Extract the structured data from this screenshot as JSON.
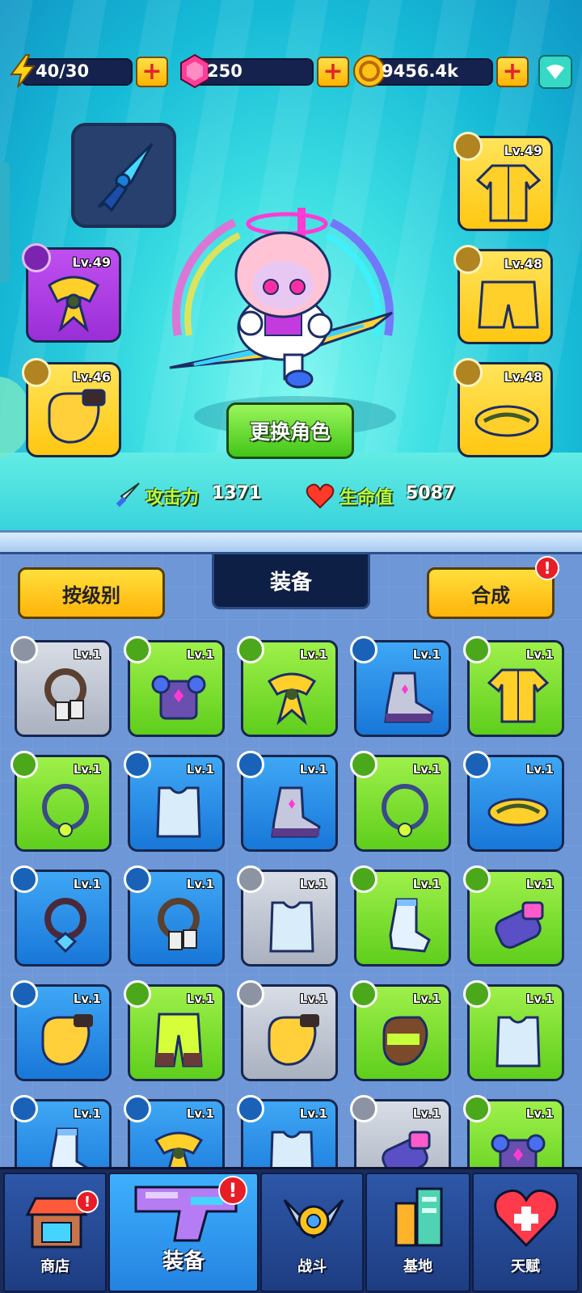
{
  "resources": {
    "energy": "40/30",
    "gems": "250",
    "coins": "9456.4k"
  },
  "hero_slots": {
    "left": [
      {
        "slot": "necklace",
        "level": "Lv.49",
        "rarity": "purple"
      },
      {
        "slot": "glove",
        "level": "Lv.46",
        "rarity": "yellow"
      }
    ],
    "right": [
      {
        "slot": "armor",
        "level": "Lv.49",
        "rarity": "yellow"
      },
      {
        "slot": "pants",
        "level": "Lv.48",
        "rarity": "yellow"
      },
      {
        "slot": "shoes",
        "level": "Lv.48",
        "rarity": "yellow"
      }
    ]
  },
  "change_character_label": "更换角色",
  "stats": {
    "attack_label": "攻击力",
    "attack_value": "1371",
    "hp_label": "生命值",
    "hp_value": "5087"
  },
  "inventory": {
    "sort_label": "按级别",
    "tab_title": "装备",
    "compose_label": "合成",
    "compose_badge": "!",
    "items": [
      {
        "type": "necklace",
        "rarity": "gray",
        "level": "Lv.1",
        "art": "tag-necklace"
      },
      {
        "type": "armor",
        "rarity": "green",
        "level": "Lv.1",
        "art": "armor"
      },
      {
        "type": "necklace",
        "rarity": "green",
        "level": "Lv.1",
        "art": "scarf"
      },
      {
        "type": "shoes",
        "rarity": "blue",
        "level": "Lv.1",
        "art": "boot"
      },
      {
        "type": "armor",
        "rarity": "green",
        "level": "Lv.1",
        "art": "shirt"
      },
      {
        "type": "necklace",
        "rarity": "green",
        "level": "Lv.1",
        "art": "ring-necklace"
      },
      {
        "type": "armor",
        "rarity": "blue",
        "level": "Lv.1",
        "art": "vest"
      },
      {
        "type": "shoes",
        "rarity": "blue",
        "level": "Lv.1",
        "art": "boot"
      },
      {
        "type": "necklace",
        "rarity": "green",
        "level": "Lv.1",
        "art": "ring-necklace"
      },
      {
        "type": "shoes",
        "rarity": "blue",
        "level": "Lv.1",
        "art": "sandal"
      },
      {
        "type": "necklace",
        "rarity": "blue",
        "level": "Lv.1",
        "art": "gem-necklace"
      },
      {
        "type": "necklace",
        "rarity": "blue",
        "level": "Lv.1",
        "art": "tag-necklace"
      },
      {
        "type": "armor",
        "rarity": "gray",
        "level": "Lv.1",
        "art": "vest"
      },
      {
        "type": "shoes",
        "rarity": "green",
        "level": "Lv.1",
        "art": "sock"
      },
      {
        "type": "glove",
        "rarity": "green",
        "level": "Lv.1",
        "art": "gauntlet"
      },
      {
        "type": "glove",
        "rarity": "blue",
        "level": "Lv.1",
        "art": "glove"
      },
      {
        "type": "pants",
        "rarity": "green",
        "level": "Lv.1",
        "art": "pants"
      },
      {
        "type": "glove",
        "rarity": "gray",
        "level": "Lv.1",
        "art": "glove"
      },
      {
        "type": "glove",
        "rarity": "green",
        "level": "Lv.1",
        "art": "fist"
      },
      {
        "type": "armor",
        "rarity": "green",
        "level": "Lv.1",
        "art": "vest"
      },
      {
        "type": "shoes",
        "rarity": "blue",
        "level": "Lv.1",
        "art": "sock"
      },
      {
        "type": "necklace",
        "rarity": "blue",
        "level": "Lv.1",
        "art": "scarf"
      },
      {
        "type": "armor",
        "rarity": "blue",
        "level": "Lv.1",
        "art": "vest"
      },
      {
        "type": "glove",
        "rarity": "gray",
        "level": "Lv.1",
        "art": "gauntlet"
      },
      {
        "type": "armor",
        "rarity": "green",
        "level": "Lv.1",
        "art": "armor"
      }
    ]
  },
  "nav": [
    {
      "label": "商店",
      "icon": "shop-icon",
      "badge": "!"
    },
    {
      "label": "装备",
      "icon": "equipment-gun-icon",
      "badge": "!",
      "active": true
    },
    {
      "label": "战斗",
      "icon": "battle-icon"
    },
    {
      "label": "基地",
      "icon": "base-icon"
    },
    {
      "label": "天赋",
      "icon": "talent-icon"
    }
  ],
  "colors": {
    "rarity_gray": "#aab1bf",
    "rarity_green": "#5fce1c",
    "rarity_blue": "#1877d8",
    "rarity_yellow": "#ffc712",
    "rarity_purple": "#9a2fd7",
    "badge_red": "#e81d26"
  }
}
